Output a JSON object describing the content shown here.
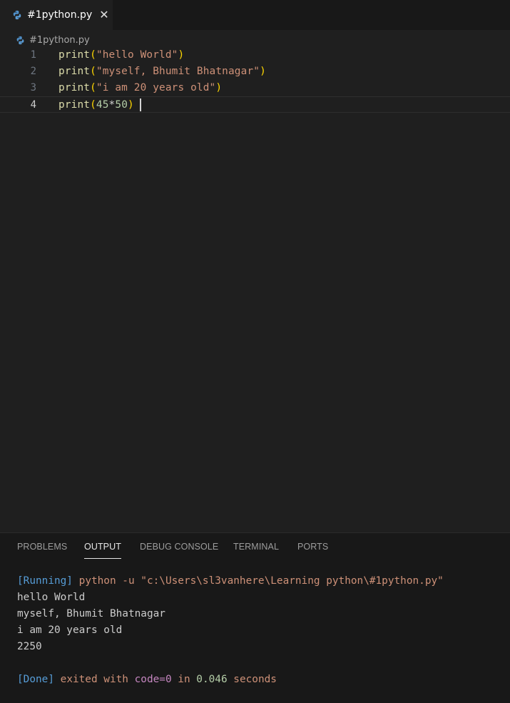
{
  "tab": {
    "filename": "#1python.py",
    "icon": "python-icon",
    "close_glyph": "✕"
  },
  "breadcrumb": {
    "filename": "#1python.py",
    "icon": "python-icon"
  },
  "editor": {
    "lines": [
      {
        "number": "1",
        "fn": "print",
        "open": "(",
        "arg": "\"hello World\"",
        "close": ")"
      },
      {
        "number": "2",
        "fn": "print",
        "open": "(",
        "arg": "\"myself, Bhumit Bhatnagar\"",
        "close": ")"
      },
      {
        "number": "3",
        "fn": "print",
        "open": "(",
        "arg": "\"i am 20 years old\"",
        "close": ")"
      },
      {
        "number": "4",
        "fn": "print",
        "open": "(",
        "num1": "45",
        "op": "*",
        "num2": "50",
        "close": ")"
      }
    ],
    "active_line": 4
  },
  "panel": {
    "tabs": [
      "PROBLEMS",
      "OUTPUT",
      "DEBUG CONSOLE",
      "TERMINAL",
      "PORTS"
    ],
    "active_tab": "OUTPUT",
    "output": {
      "running_tag": "[Running]",
      "command": "python -u \"c:\\Users\\sl3vanhere\\Learning python\\#1python.py\"",
      "lines": [
        "hello World",
        "myself, Bhumit Bhatnagar",
        "i am 20 years old",
        "2250"
      ],
      "done_tag": "[Done]",
      "exited_with": "exited with",
      "code_label": "code=0",
      "in_word": "in",
      "duration": "0.046",
      "seconds": "seconds"
    }
  },
  "colors": {
    "background": "#1f1f1f",
    "function": "#dcdcaa",
    "bracket": "#ffd700",
    "string": "#ce9178",
    "number": "#b5cea8",
    "keyword_blue": "#569cd6",
    "purple": "#c586c0"
  }
}
